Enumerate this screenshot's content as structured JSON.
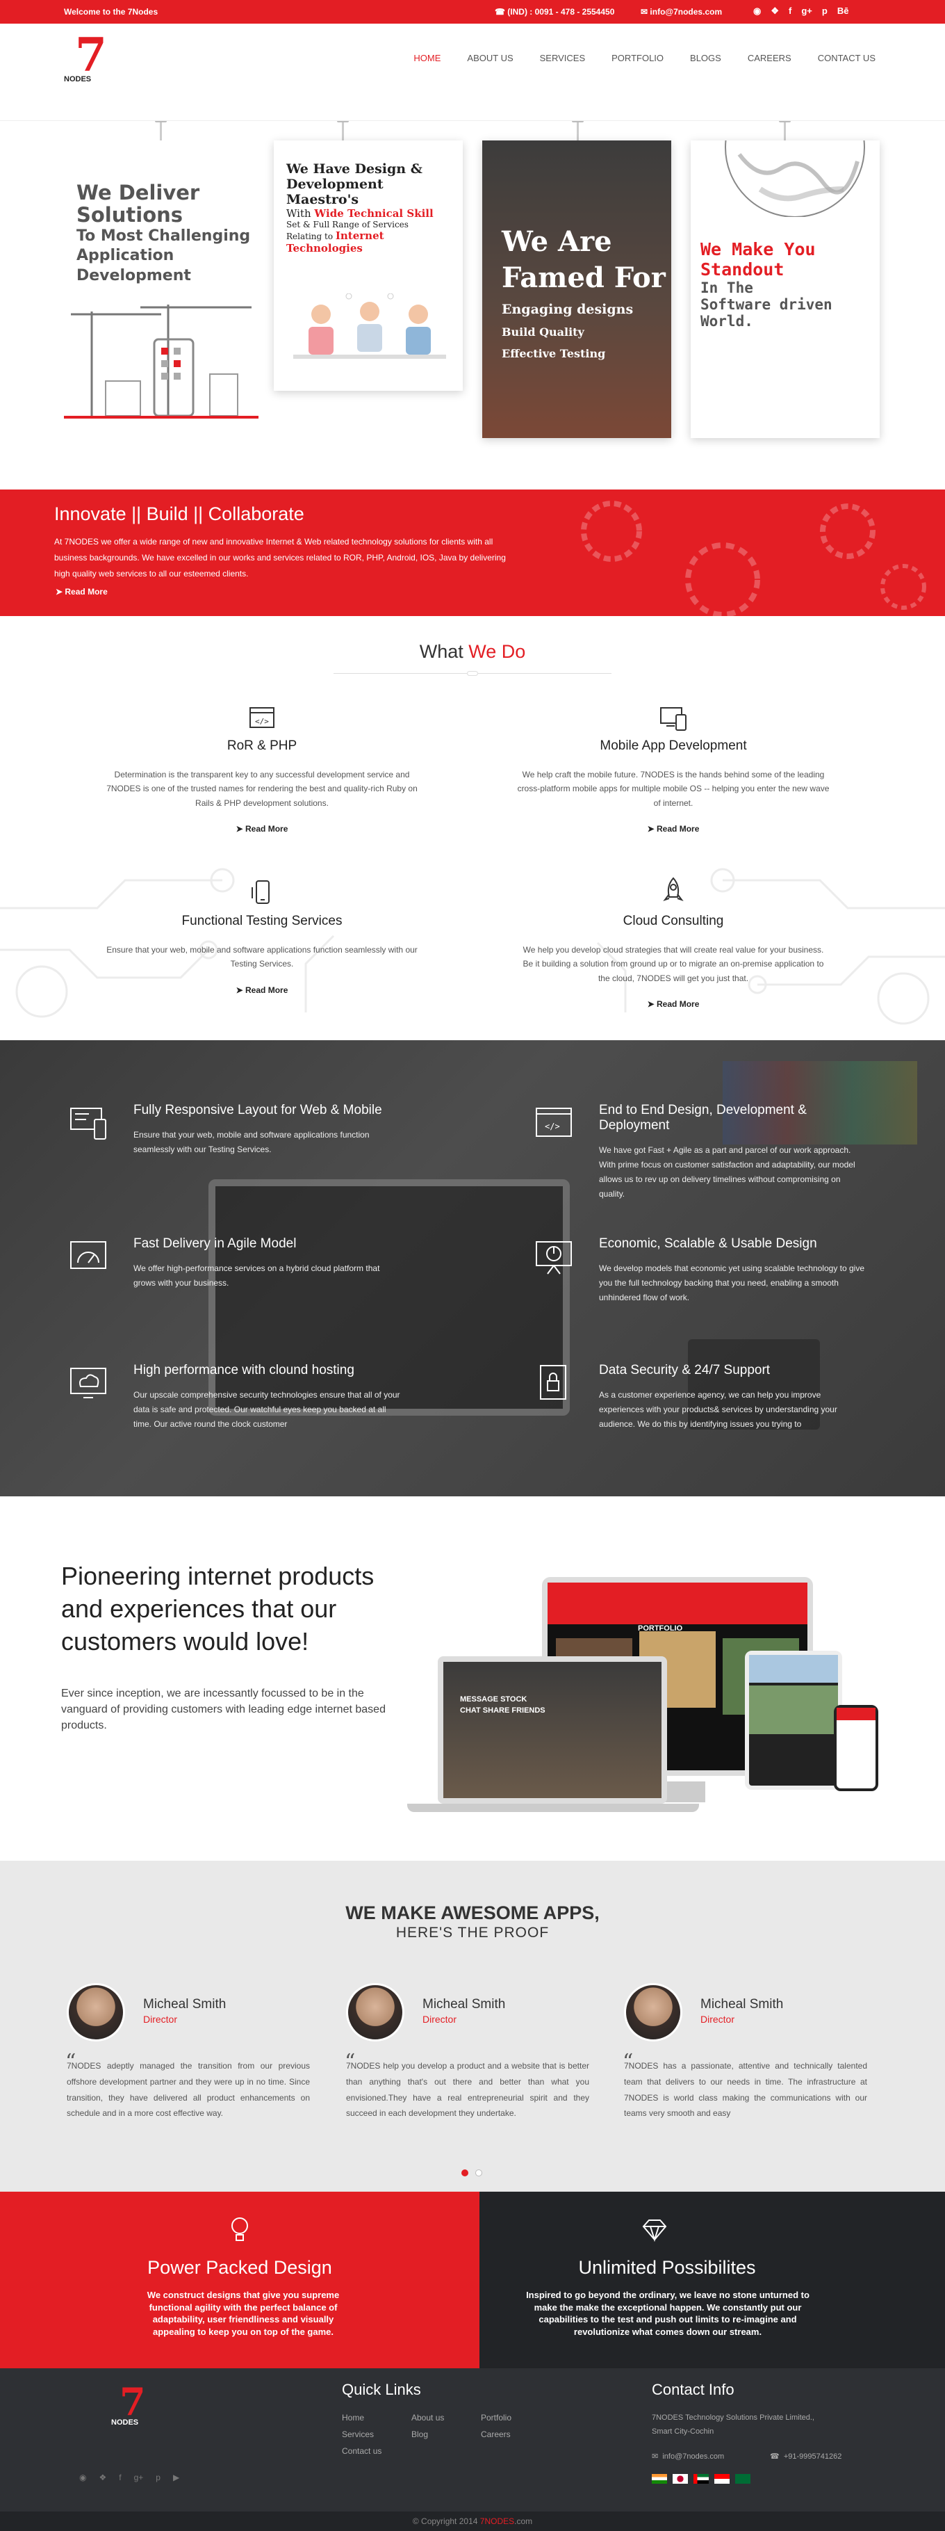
{
  "topbar": {
    "welcome": "Welcome to the 7Nodes",
    "phone": "(IND) : 0091 - 478 - 2554450",
    "email": "info@7nodes.com",
    "socials": [
      "github-icon",
      "twitter-icon",
      "facebook-icon",
      "google-plus-icon",
      "pinterest-icon",
      "behance-icon"
    ]
  },
  "header": {
    "logo_brand": "NODES",
    "logo_digit": "7",
    "nav": [
      "HOME",
      "ABOUT US",
      "SERVICES",
      "PORTFOLIO",
      "BLOGS",
      "CAREERS",
      "CONTACT US"
    ]
  },
  "hero": {
    "card1": {
      "line1": "We Deliver",
      "line2": "Solutions",
      "line3": "To Most Challenging",
      "line4": "Application",
      "line5": "Development"
    },
    "card2": {
      "line1": "We Have Design &",
      "line2": "Development",
      "line3": "Maestro's",
      "line4a": "With ",
      "line4b": "Wide Technical Skill",
      "line5": "Set & Full Range of Services",
      "line6a": "Relating to ",
      "line6b": "Internet",
      "line7": "Technologies"
    },
    "card3": {
      "line1": "We Are",
      "line2": "Famed For",
      "line3": "Engaging designs",
      "line4": "Build Quality",
      "line5": "Effective Testing"
    },
    "card4": {
      "line1": "We Make You",
      "line2": "Standout",
      "line3": "In The",
      "line4": "Software driven",
      "line5": "World."
    }
  },
  "innovate": {
    "title": "Innovate || Build || Collaborate",
    "desc": "At 7NODES we offer a wide range of new and innovative Internet & Web related technology solutions for clients with all business backgrounds. We have excelled in our works and services related to ROR, PHP, Android, IOS, Java by delivering high quality web services to all our esteemed clients.",
    "read_more": "Read More"
  },
  "whatwedo": {
    "title_a": "What ",
    "title_b": "We Do",
    "services": [
      {
        "title": "RoR & PHP",
        "desc": "Determination is the transparent key to any successful development service and 7NODES is one of the trusted names for rendering the best and quality-rich Ruby on Rails & PHP development solutions.",
        "read_more": "Read More"
      },
      {
        "title": "Mobile App Development",
        "desc": "We help craft the mobile future. 7NODES is the hands behind some of the leading cross-platform mobile apps for multiple mobile OS -- helping you enter the new wave of internet.",
        "read_more": "Read More"
      },
      {
        "title": "Functional Testing Services",
        "desc": "Ensure that your web, mobile and software applications function seamlessly with our Testing Services.",
        "read_more": "Read More"
      },
      {
        "title": "Cloud Consulting",
        "desc": "We help you develop cloud strategies that will create real value for your business. Be it building a solution from ground up or to migrate an on-premise application to the cloud, 7NODES will get you just that.",
        "read_more": "Read More"
      }
    ]
  },
  "features": [
    {
      "title": "Fully Responsive Layout for  Web & Mobile",
      "desc": "Ensure that your web, mobile and software applications function seamlessly with our Testing Services.",
      "icon": "responsive-layout-icon"
    },
    {
      "title": "End to End Design, Development & Deployment",
      "desc": "We have got Fast + Agile as a part and parcel of our work approach. With prime focus on customer satisfaction and adaptability, our model allows us to rev up on delivery timelines without compromising on quality.",
      "icon": "browser-code-icon"
    },
    {
      "title": "Fast Delivery in Agile Model",
      "desc": "We offer high-performance services on a hybrid cloud platform that grows with your business.",
      "icon": "speed-gauge-icon"
    },
    {
      "title": "Economic, Scalable & Usable Design",
      "desc": "We develop models that economic yet using scalable technology to give you the full technology backing that you need, enabling a smooth unhindered flow of work.",
      "icon": "presentation-chart-icon"
    },
    {
      "title": "High performance with clound hosting",
      "desc": "Our upscale comprehensive security technologies ensure that all of your data is safe and protected. Our watchful eyes keep you backed at all time. Our active round the clock customer",
      "icon": "cloud-hosting-icon"
    },
    {
      "title": "Data Security & 24/7 Support",
      "desc": "As a customer experience agency, we can help you improve experiences with your products& services by understanding your audience. We do this by identifying issues you trying to",
      "icon": "security-lock-icon"
    }
  ],
  "pioneer": {
    "title": "Pioneering internet products and experiences that our customers would love!",
    "desc": "Ever since inception, we are incessantly focussed to be in the vanguard of providing customers with leading edge internet based products.",
    "screen_label_1": "MESSAGE STOCK",
    "screen_label_2": "CHAT SHARE FRIENDS",
    "screen_label_3": "PORTFOLIO"
  },
  "testimonials": {
    "title": "WE MAKE AWESOME APPS,",
    "subtitle": "HERE'S THE PROOF",
    "items": [
      {
        "name": "Micheal Smith",
        "role": "Director",
        "quote": "7NODES adeptly managed the transition from our previous offshore development partner and they were up in no time. Since transition, they have delivered all product enhancements on schedule and in a more cost effective way."
      },
      {
        "name": "Micheal Smith",
        "role": "Director",
        "quote": "7NODES help you develop a product and a website that is better than anything that's out there and better than what you envisioned.They have a real entrepreneurial spirit and they succeed in each development they undertake."
      },
      {
        "name": "Micheal Smith",
        "role": "Director",
        "quote": "7NODES has a passionate, attentive and technically talented team that delivers to our needs in time. The infrastructure at 7NODES is world class making the communications with our teams very smooth and easy"
      }
    ],
    "dots": 2,
    "active_dot": 0
  },
  "power": {
    "left_title": "Power Packed Design",
    "left_desc": "We construct designs that give you supreme functional agility with the perfect balance of adaptability, user friendliness and visually appealing to keep you on top of the game.",
    "right_title": "Unlimited Possibilites",
    "right_desc": "Inspired to go beyond the ordinary, we leave no stone unturned to make the make the exceptional happen. We constantly put our capabilities to the test and push out limits to re-imagine and revolutionize what comes down our stream."
  },
  "footer": {
    "quick_links_title": "Quick Links",
    "links": [
      "Home",
      "About us",
      "Portfolio",
      "Services",
      "Blog",
      "Careers",
      "Contact us"
    ],
    "contact_title": "Contact Info",
    "address_1": "7NODES Technology Solutions Private Limited.,",
    "address_2": "Smart City-Cochin",
    "email": "info@7nodes.com",
    "phone": "+91-9995741262",
    "socials": [
      "github-icon",
      "twitter-icon",
      "facebook-icon",
      "google-plus-icon",
      "pinterest-icon",
      "youtube-icon"
    ]
  },
  "copyright": {
    "prefix": "© Copyright 2014 ",
    "brand": "7NODES",
    "suffix": ".com"
  },
  "colors": {
    "accent": "#e31e24",
    "dark": "#222427",
    "footer": "#2e3034"
  }
}
